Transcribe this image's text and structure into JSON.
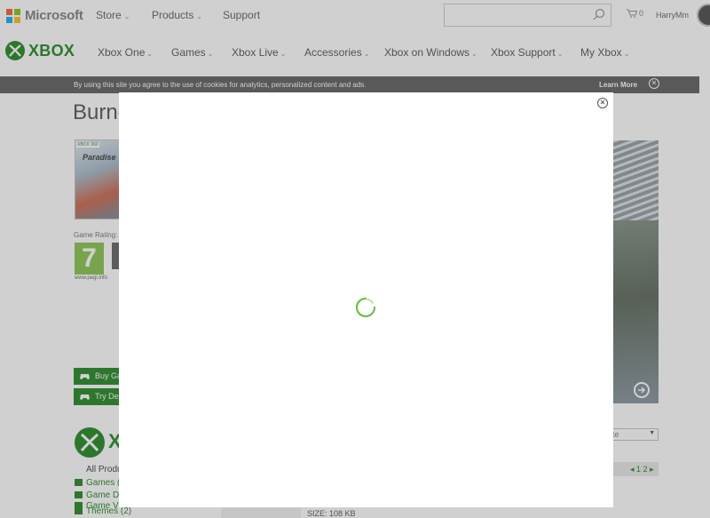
{
  "header": {
    "brand": "Microsoft",
    "nav": [
      "Store",
      "Products",
      "Support"
    ],
    "search_placeholder": "",
    "cart_count": "0",
    "user": "HarryMm"
  },
  "xbox_nav": {
    "brand": "XBOX",
    "items": [
      "Xbox One",
      "Games",
      "Xbox Live",
      "Accessories",
      "Xbox on Windows",
      "Xbox Support",
      "My Xbox"
    ]
  },
  "cookie_bar": {
    "text": "By using this site you agree to the use of cookies for analytics, personalized content and ads.",
    "learn_more": "Learn More",
    "close": "✕"
  },
  "product": {
    "title": "Burne",
    "box_badge": "XBOX 360",
    "box_title": "Paradise",
    "rating_label": "Game Rating:",
    "pegi_number": "7",
    "pegi_url": "www.pegi.info",
    "buy_label": "Buy Ga",
    "demo_label": "Try De"
  },
  "products_panel": {
    "brand": "X",
    "all_products": "All Produ",
    "categories": [
      "Games (",
      "Game De",
      "Game V",
      "Themes (2)"
    ],
    "sort_value": "ate",
    "pager": "1 2",
    "size_text": "SIZE: 108 KB"
  },
  "modal": {
    "close": "✕"
  },
  "colors": {
    "xbox_green": "#107c10",
    "ms_red": "#f25022",
    "ms_green": "#7fba00",
    "ms_blue": "#00a4ef",
    "ms_yellow": "#ffb900"
  }
}
